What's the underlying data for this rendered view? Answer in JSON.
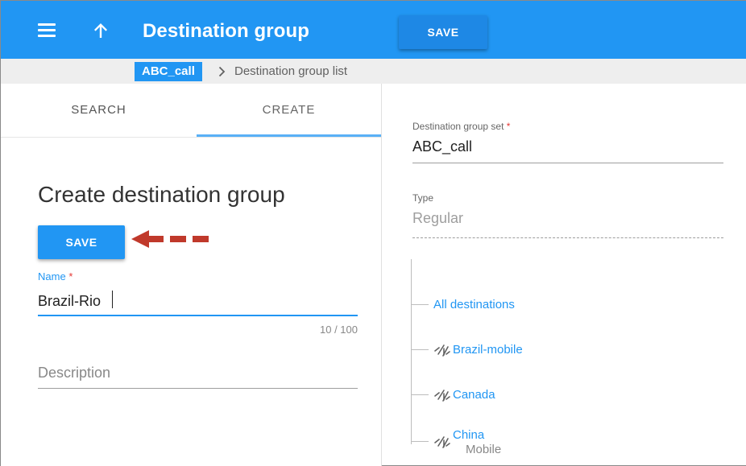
{
  "header": {
    "title": "Destination group",
    "save_label": "SAVE",
    "icons": {
      "menu": "menu-icon",
      "up": "arrow-up-icon"
    },
    "color": "#2196f3"
  },
  "breadcrumb": {
    "root": "ABC_call",
    "current": "Destination group list"
  },
  "tabs": [
    {
      "label": "SEARCH",
      "active": false
    },
    {
      "label": "CREATE",
      "active": true
    }
  ],
  "form": {
    "title": "Create destination group",
    "save_label": "SAVE",
    "name": {
      "label": "Name",
      "required_mark": "*",
      "value": "Brazil-Rio",
      "counter": "10 / 100"
    },
    "description": {
      "placeholder": "Description",
      "value": ""
    }
  },
  "details": {
    "set": {
      "label": "Destination group set",
      "required_mark": "*",
      "value": "ABC_call"
    },
    "type": {
      "label": "Type",
      "value": "Regular"
    }
  },
  "tree": {
    "root": "All destinations",
    "items": [
      {
        "label": "Brazil-mobile",
        "sub": "",
        "icon": "destination-icon"
      },
      {
        "label": "Canada",
        "sub": "",
        "icon": "destination-icon"
      },
      {
        "label": "China",
        "sub": "Mobile",
        "icon": "destination-icon"
      }
    ]
  }
}
